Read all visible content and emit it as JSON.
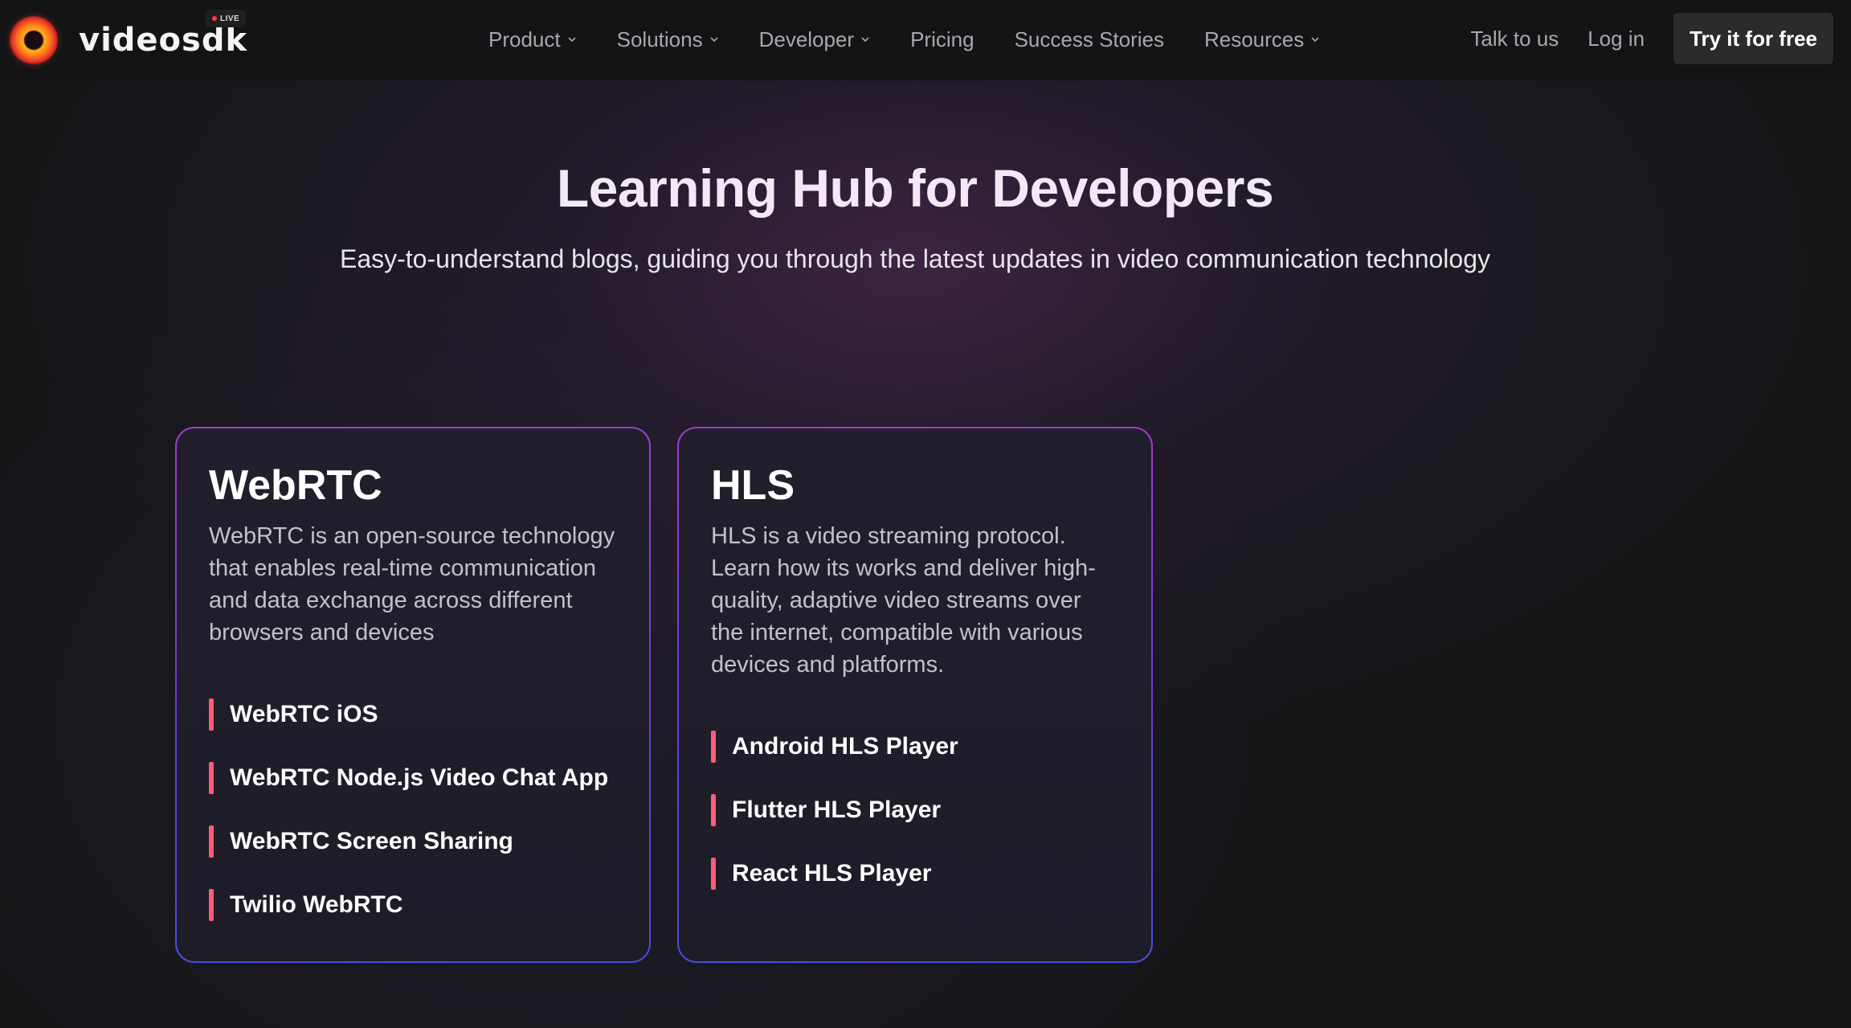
{
  "nav": {
    "brand": "videosdk",
    "live_badge": "LIVE",
    "menu": [
      {
        "label": "Product",
        "has_dropdown": true
      },
      {
        "label": "Solutions",
        "has_dropdown": true
      },
      {
        "label": "Developer",
        "has_dropdown": true
      },
      {
        "label": "Pricing",
        "has_dropdown": false
      },
      {
        "label": "Success Stories",
        "has_dropdown": false
      },
      {
        "label": "Resources",
        "has_dropdown": true
      }
    ],
    "talk_label": "Talk to us",
    "login_label": "Log in",
    "cta_label": "Try it for free"
  },
  "hero": {
    "title": "Learning Hub for Developers",
    "subtitle": "Easy-to-understand blogs, guiding you through the latest updates in video communication technology"
  },
  "cards": [
    {
      "title": "WebRTC",
      "description": "WebRTC is an open-source technology that enables real-time communication and data exchange across different browsers and devices",
      "links": [
        "WebRTC iOS",
        "WebRTC Node.js Video Chat App",
        "WebRTC Screen Sharing",
        "Twilio WebRTC"
      ]
    },
    {
      "title": "HLS",
      "description": "HLS is a video streaming protocol. Learn how its works and deliver high-quality, adaptive video streams over the internet, compatible with various devices and platforms.",
      "links": [
        "Android HLS Player",
        "Flutter HLS Player",
        "React HLS Player"
      ]
    }
  ],
  "colors": {
    "background": "#161618",
    "accent_bar": "#ff5c7a",
    "card_border_top": "#a23bd0",
    "card_border_bottom": "#4a4ee0",
    "cta_bg": "#2b2b2e"
  }
}
